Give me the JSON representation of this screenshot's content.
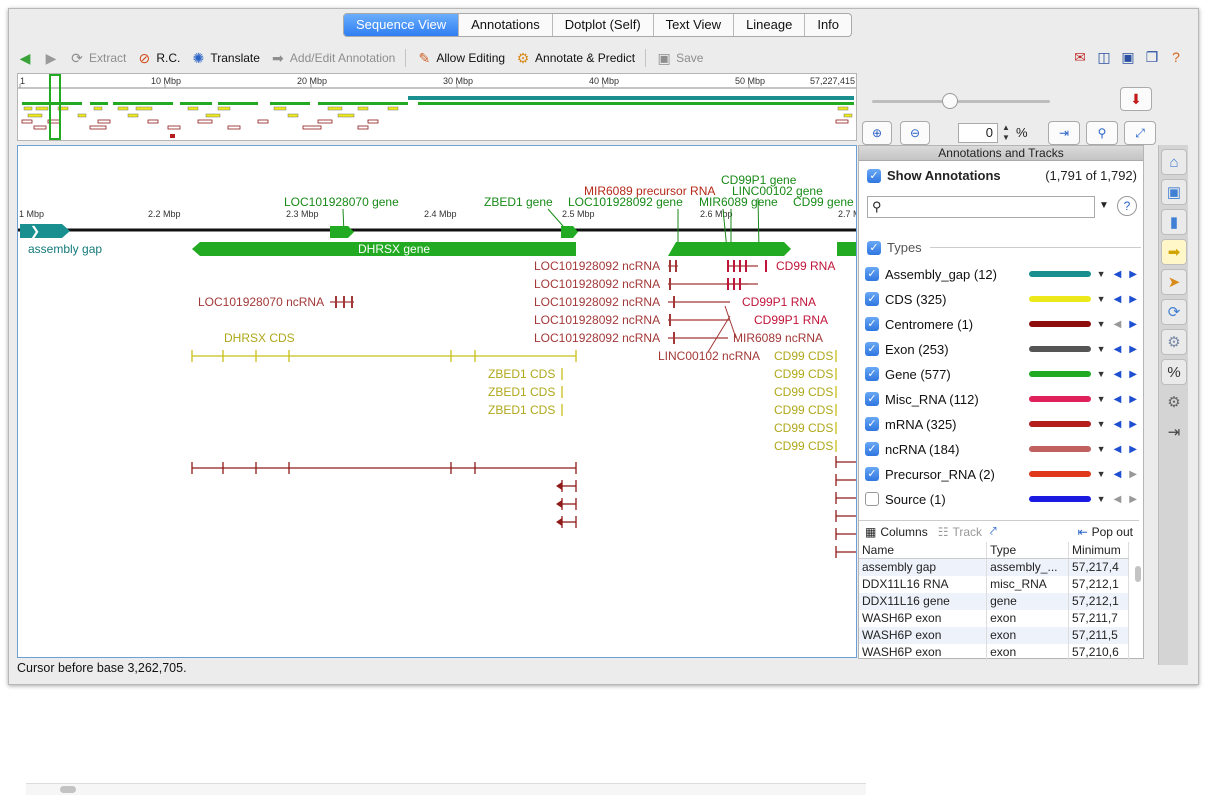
{
  "tabs": [
    "Sequence View",
    "Annotations",
    "Dotplot (Self)",
    "Text View",
    "Lineage",
    "Info"
  ],
  "toolbar": {
    "extract": "Extract",
    "rc": "R.C.",
    "translate": "Translate",
    "add_edit": "Add/Edit Annotation",
    "allow_editing": "Allow Editing",
    "annotate_predict": "Annotate & Predict",
    "save": "Save"
  },
  "overview": {
    "ticks": [
      "1",
      "10 Mbp",
      "20 Mbp",
      "30 Mbp",
      "40 Mbp",
      "50 Mbp",
      "57,227,415"
    ]
  },
  "zoom": {
    "value": "0",
    "unit": "%"
  },
  "ruler": [
    "1 Mbp",
    "2.2 Mbp",
    "2.3 Mbp",
    "2.4 Mbp",
    "2.5 Mbp",
    "2.6 Mbp",
    "2.7 M"
  ],
  "features": {
    "assembly_gap": "assembly gap",
    "loc_gene": "LOC101928070 gene",
    "zbed1_gene": "ZBED1 gene",
    "mir_precursor": "MIR6089 precursor RNA",
    "loc92_gene": "LOC101928092 gene",
    "cd99p1_gene": "CD99P1 gene",
    "linc_gene": "LINC00102 gene",
    "mir_gene": "MIR6089 gene",
    "cd99_gene": "CD99 gene",
    "dhrsx_gene": "DHRSX gene",
    "loc92_ncrna": "LOC101928092 ncRNA",
    "cd99_rna": "CD99 RNA",
    "loc70_ncrna": "LOC101928070 ncRNA",
    "cd99p1_rna": "CD99P1 RNA",
    "dhrsx_cds": "DHRSX CDS",
    "mir_ncrna": "MIR6089 ncRNA",
    "linc_ncrna": "LINC00102 ncRNA",
    "zbed1_cds": "ZBED1 CDS",
    "cd99_cds": "CD99 CDS"
  },
  "status": "Cursor before base 3,262,705.",
  "annotations_panel": {
    "header": "Annotations and Tracks",
    "show_label": "Show Annotations",
    "show_count": "(1,791 of 1,792)",
    "types_label": "Types",
    "types": [
      {
        "label": "Assembly_gap (12)",
        "color": "#1a8f8f",
        "checked": true
      },
      {
        "label": "CDS (325)",
        "color": "#ece81a",
        "checked": true
      },
      {
        "label": "Centromere (1)",
        "color": "#8e0d0d",
        "checked": true
      },
      {
        "label": "Exon (253)",
        "color": "#555555",
        "checked": true
      },
      {
        "label": "Gene (577)",
        "color": "#22aa22",
        "checked": true
      },
      {
        "label": "Misc_RNA (112)",
        "color": "#e0205a",
        "checked": true
      },
      {
        "label": "mRNA (325)",
        "color": "#b51c1c",
        "checked": true
      },
      {
        "label": "ncRNA (184)",
        "color": "#c06060",
        "checked": true
      },
      {
        "label": "Precursor_RNA (2)",
        "color": "#e0381a",
        "checked": true
      },
      {
        "label": "Source (1)",
        "color": "#1a1ae0",
        "checked": false
      }
    ],
    "columns_label": "Columns",
    "track_label": "Track",
    "popout_label": "Pop out",
    "table": {
      "headers": [
        "Name",
        "Type",
        "Minimum"
      ],
      "rows": [
        [
          "assembly gap",
          "assembly_...",
          "57,217,4"
        ],
        [
          "DDX11L16 RNA",
          "misc_RNA",
          "57,212,1"
        ],
        [
          "DDX11L16 gene",
          "gene",
          "57,212,1"
        ],
        [
          "WASH6P exon",
          "exon",
          "57,211,7"
        ],
        [
          "WASH6P exon",
          "exon",
          "57,211,5"
        ],
        [
          "WASH6P exon",
          "exon",
          "57,210,6"
        ]
      ]
    }
  }
}
